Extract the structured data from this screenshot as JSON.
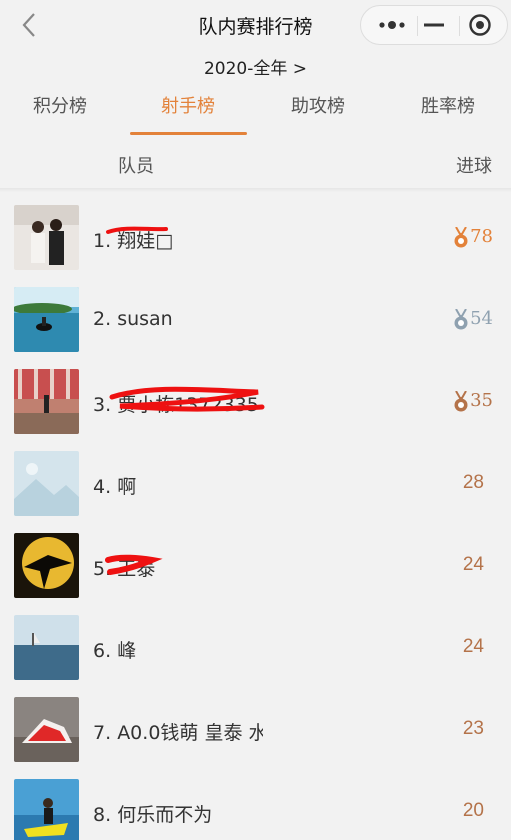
{
  "header": {
    "title": "队内赛排行榜"
  },
  "year_filter": {
    "label": "2020-全年 >"
  },
  "tabs": [
    {
      "label": "积分榜",
      "active": false
    },
    {
      "label": "射手榜",
      "active": true
    },
    {
      "label": "助攻榜",
      "active": false
    },
    {
      "label": "胜率榜",
      "active": false
    }
  ],
  "columns": {
    "member": "队员",
    "goals": "进球"
  },
  "colors": {
    "accent": "#e3823a",
    "gold": "#e3823a",
    "silver": "#8fa1b0",
    "bronze": "#b4734a",
    "goals_text": "#b4734a",
    "redaction": "#ee1111"
  },
  "players": [
    {
      "rank": "1",
      "name": "翔娃□",
      "goals": "78",
      "medal": "gold"
    },
    {
      "rank": "2",
      "name": "susan",
      "goals": "54",
      "medal": "silver"
    },
    {
      "rank": "3",
      "name": "贾小栋1372335",
      "goals": "35",
      "medal": "bronze"
    },
    {
      "rank": "4",
      "name": "啊",
      "goals": "28",
      "medal": ""
    },
    {
      "rank": "5",
      "name": "王泰",
      "goals": "24",
      "medal": ""
    },
    {
      "rank": "6",
      "name": "峰",
      "goals": "24",
      "medal": ""
    },
    {
      "rank": "7",
      "name": "A0.0钱萌 皇泰 水",
      "goals": "23",
      "medal": ""
    },
    {
      "rank": "8",
      "name": "何乐而不为",
      "goals": "20",
      "medal": ""
    }
  ]
}
